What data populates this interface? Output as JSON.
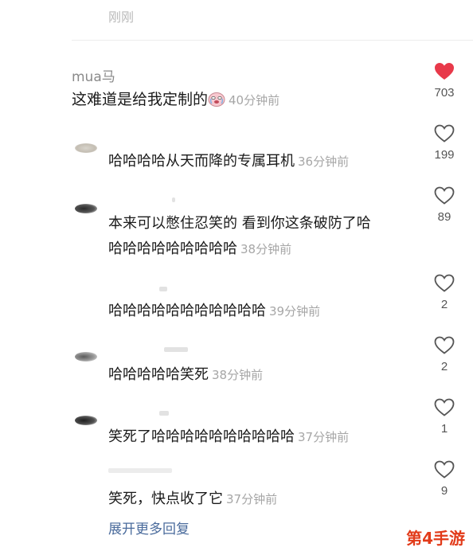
{
  "top": {
    "faded_text": "刚刚"
  },
  "main_comment": {
    "username": "mua马",
    "text": "这难道是给我定制的",
    "time": "40分钟前",
    "likes": "703",
    "liked": true
  },
  "replies": [
    {
      "text": "哈哈哈哈从天而降的专属耳机",
      "time": "36分钟前",
      "likes": "199"
    },
    {
      "text_line1": "本来可以憋住忍笑的 看到你这条破防了哈",
      "text_line2": "哈哈哈哈哈哈哈哈哈",
      "time": "38分钟前",
      "likes": "89"
    },
    {
      "text": "哈哈哈哈哈哈哈哈哈哈哈",
      "time": "39分钟前",
      "likes": "2"
    },
    {
      "text": "哈哈哈哈哈笑死",
      "time": "38分钟前",
      "likes": "2"
    },
    {
      "text": "笑死了哈哈哈哈哈哈哈哈哈哈",
      "time": "37分钟前",
      "likes": "1"
    },
    {
      "text": "笑死，快点收了它",
      "time": "37分钟前",
      "likes": "9"
    }
  ],
  "expand_label": "展开更多回复",
  "watermark": "第4手游",
  "colors": {
    "like_red": "#e8394a",
    "link_blue": "#4a6b9c",
    "watermark": "#e23b1a"
  }
}
